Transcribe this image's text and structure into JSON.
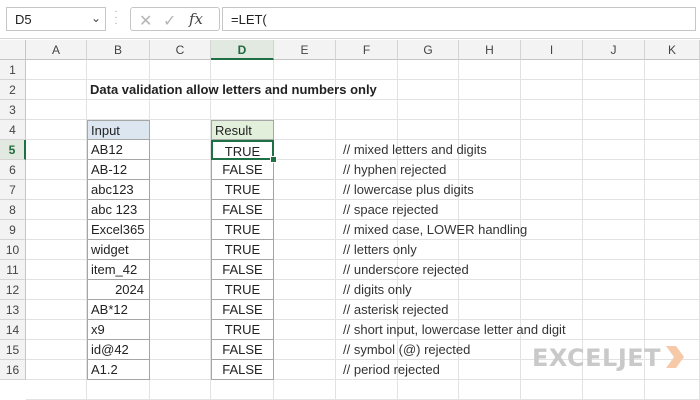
{
  "namebox": {
    "value": "D5"
  },
  "formula": {
    "value": "=LET(",
    "fx_label": "fx"
  },
  "columns": [
    "A",
    "B",
    "C",
    "D",
    "E",
    "F",
    "G",
    "H",
    "I",
    "J",
    "K"
  ],
  "rows": [
    "1",
    "2",
    "3",
    "4",
    "5",
    "6",
    "7",
    "8",
    "9",
    "10",
    "11",
    "12",
    "13",
    "14",
    "15",
    "16"
  ],
  "sheet": {
    "title": "Data validation allow letters and numbers only",
    "input_header": "Input",
    "result_header": "Result",
    "entries": [
      {
        "input": "AB12",
        "result": "TRUE",
        "note": "//  mixed letters and digits"
      },
      {
        "input": "AB-12",
        "result": "FALSE",
        "note": "//  hyphen rejected"
      },
      {
        "input": "abc123",
        "result": "TRUE",
        "note": "//  lowercase plus digits"
      },
      {
        "input": "abc 123",
        "result": "FALSE",
        "note": "//  space rejected"
      },
      {
        "input": "Excel365",
        "result": "TRUE",
        "note": "//  mixed case, LOWER handling"
      },
      {
        "input": "widget",
        "result": "TRUE",
        "note": "//  letters only"
      },
      {
        "input": "item_42",
        "result": "FALSE",
        "note": "//  underscore rejected"
      },
      {
        "input": "2024",
        "result": "TRUE",
        "note": "//  digits only"
      },
      {
        "input": "AB*12",
        "result": "FALSE",
        "note": "//  asterisk rejected"
      },
      {
        "input": "x9",
        "result": "TRUE",
        "note": "//  short input, lowercase letter and digit"
      },
      {
        "input": "id@42",
        "result": "FALSE",
        "note": "//  symbol (@) rejected"
      },
      {
        "input": "A1.2",
        "result": "FALSE",
        "note": "//  period rejected"
      }
    ]
  },
  "logo": {
    "text": "EXCELJET"
  },
  "colors": {
    "accent": "#1e7145",
    "input_header_bg": "#dce6f1",
    "result_header_bg": "#e2efda"
  }
}
